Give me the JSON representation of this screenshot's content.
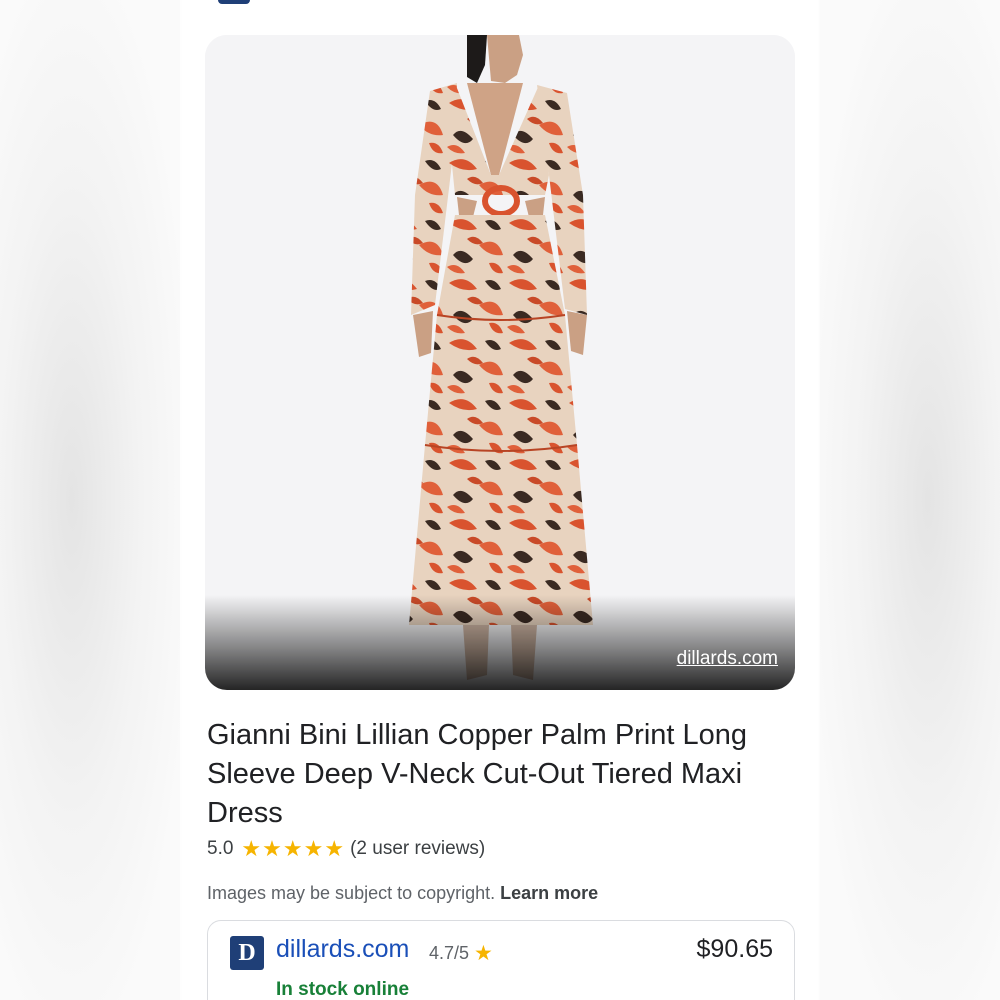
{
  "image": {
    "source_label": "dillards.com"
  },
  "product": {
    "title": "Gianni Bini Lillian Copper Palm Print Long Sleeve Deep V-Neck Cut-Out Tiered Maxi Dress",
    "rating_value": "5.0",
    "rating_fraction": 1.0,
    "reviews_label": "(2 user reviews)"
  },
  "copyright": {
    "text": "Images may be subject to copyright.",
    "learn_more": "Learn more"
  },
  "offer": {
    "merchant_logo_letter": "D",
    "merchant_name": "dillards.com",
    "merchant_rating": "4.7/5",
    "price": "$90.65",
    "stock_status": "In stock online"
  },
  "colors": {
    "star": "#f6b400",
    "link": "#1a4fb8",
    "in_stock": "#188038",
    "merchant_brand": "#1f3f77",
    "dress_print": "#d9532e"
  },
  "icons": {
    "star": "star-icon",
    "merchant": "dillards-logo-icon"
  }
}
